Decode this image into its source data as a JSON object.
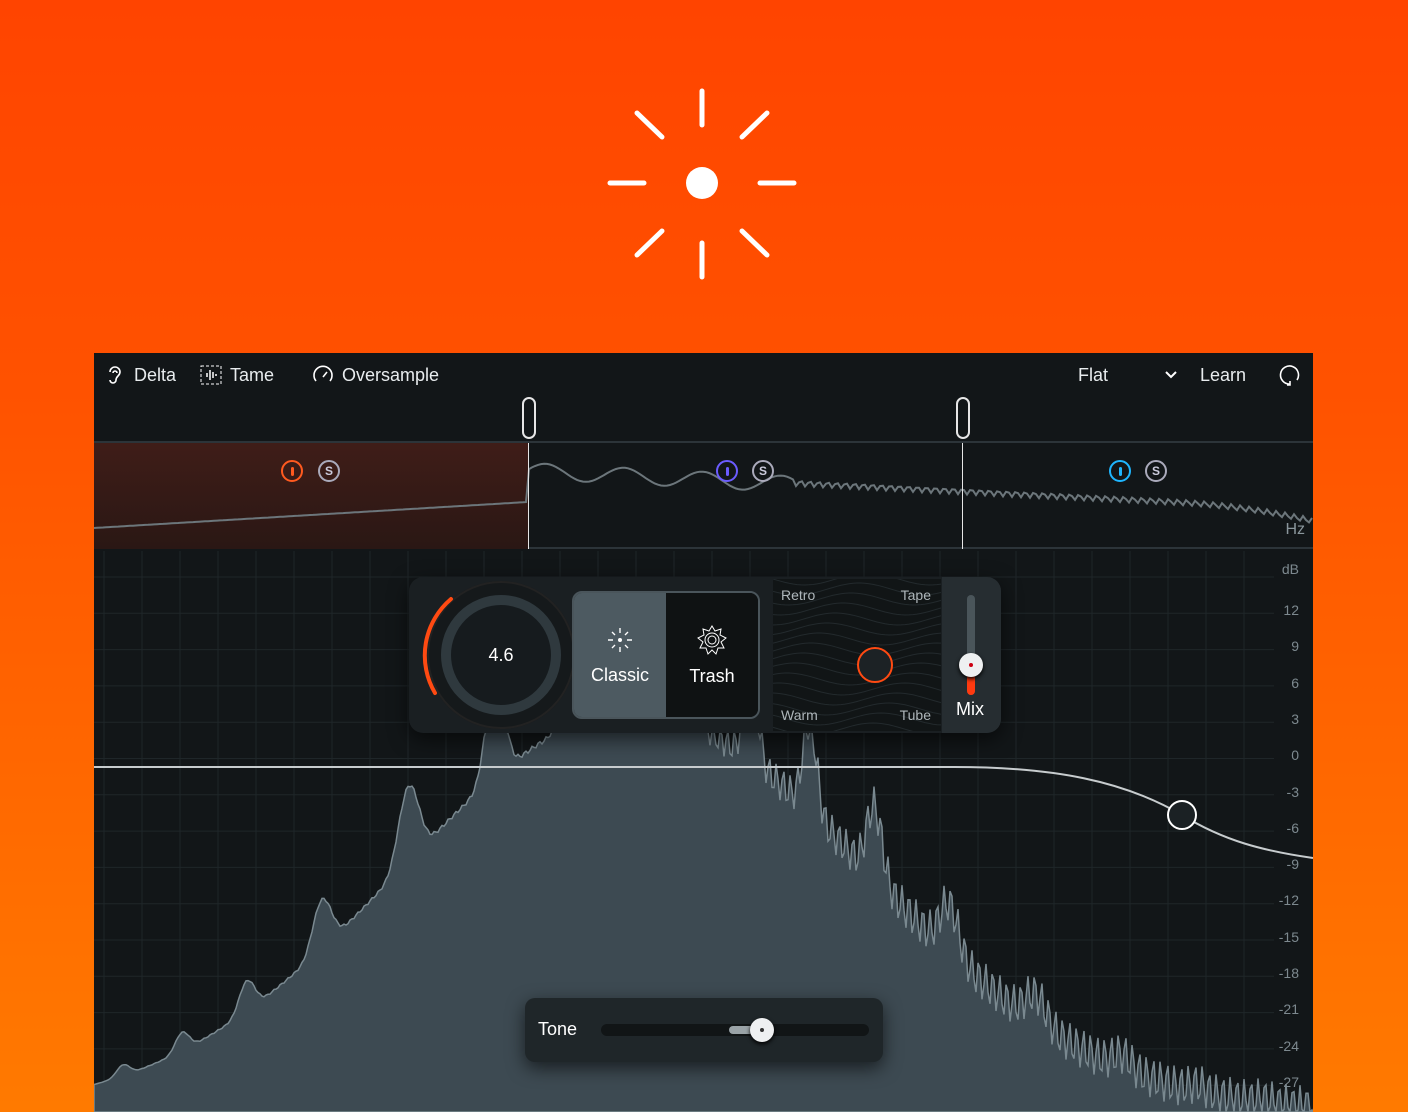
{
  "colors": {
    "accent": "#ff4a12",
    "band1": "#ff5a1f",
    "band2": "#6b5cff",
    "band3": "#1fb6ff"
  },
  "toolbar": {
    "delta": "Delta",
    "tame": "Tame",
    "oversample": "Oversample",
    "preset": "Flat",
    "learn": "Learn"
  },
  "bands": {
    "solo": "S",
    "hz": "Hz"
  },
  "db_axis": {
    "unit": "dB",
    "ticks": [
      "12",
      "9",
      "6",
      "3",
      "0",
      "-3",
      "-6",
      "-9",
      "-12",
      "-15",
      "-18",
      "-21",
      "-24",
      "-27"
    ]
  },
  "module": {
    "drive": "4.6",
    "modes": [
      "Classic",
      "Trash"
    ],
    "selected_mode": "Classic",
    "xy": {
      "tl": "Retro",
      "tr": "Tape",
      "bl": "Warm",
      "br": "Tube"
    },
    "mix_label": "Mix",
    "mix_level": 0.3
  },
  "tone": {
    "label": "Tone",
    "level": 0.6
  }
}
